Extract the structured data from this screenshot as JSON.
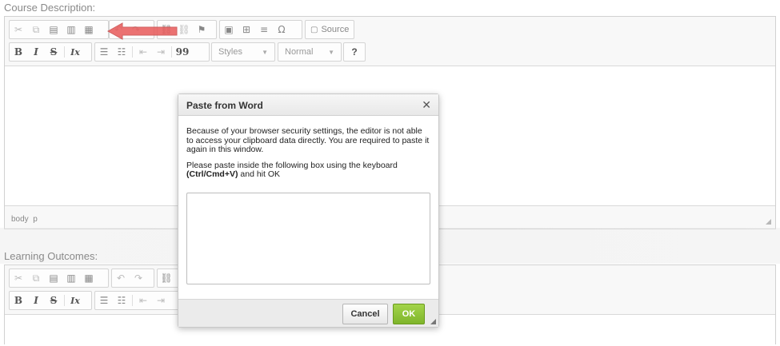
{
  "course_description": {
    "label": "Course Description:",
    "source_label": "Source",
    "styles_label": "Styles",
    "format_label": "Normal",
    "path": [
      "body",
      "p"
    ]
  },
  "learning_outcomes": {
    "label": "Learning Outcomes:"
  },
  "toolbar_glyphs": {
    "bold": "B",
    "italic": "I",
    "strike": "S",
    "remove_format": "Ix",
    "blockquote": "99",
    "help": "?"
  },
  "dialog": {
    "title": "Paste from Word",
    "close": "✕",
    "message1": "Because of your browser security settings, the editor is not able to access your clipboard data directly. You are required to paste it again in this window.",
    "message2_prefix": "Please paste inside the following box using the keyboard",
    "shortcut": "(Ctrl/Cmd+V)",
    "message2_suffix": " and hit OK",
    "paste_value": "",
    "cancel_label": "Cancel",
    "ok_label": "OK"
  },
  "colors": {
    "ok_green": "#8cc63f",
    "arrow_red": "#e85a5a"
  }
}
